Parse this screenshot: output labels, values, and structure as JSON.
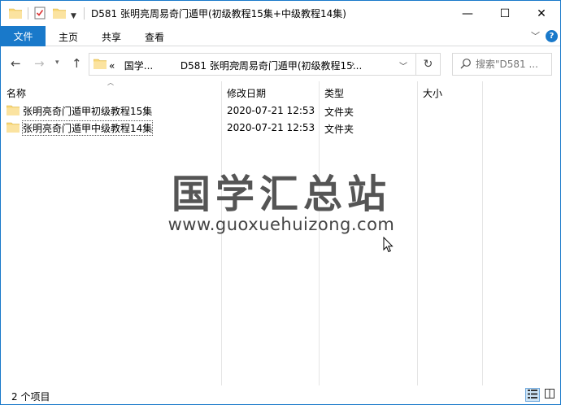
{
  "window": {
    "title": "D581 张明亮周易奇门遁甲(初级教程15集+中级教程14集)",
    "minimize": "—",
    "maximize": "☐",
    "close": "✕"
  },
  "ribbon": {
    "tabs": [
      "文件",
      "主页",
      "共享",
      "查看"
    ],
    "help": "?"
  },
  "nav": {
    "address_breadcrumb": [
      "国学...",
      "D581 张明亮周易奇门遁甲(初级教程15..."
    ],
    "address_prefix": "«",
    "search_placeholder": "搜索\"D581 ..."
  },
  "columns": {
    "name": "名称",
    "date": "修改日期",
    "type": "类型",
    "size": "大小"
  },
  "files": [
    {
      "name": "张明亮奇门遁甲初级教程15集",
      "date": "2020-07-21 12:53",
      "type": "文件夹",
      "size": ""
    },
    {
      "name": "张明亮奇门遁甲中级教程14集",
      "date": "2020-07-21 12:53",
      "type": "文件夹",
      "size": ""
    }
  ],
  "watermark": {
    "title": "国学汇总站",
    "url": "www.guoxuehuizong.com"
  },
  "status": {
    "count": "2 个项目"
  },
  "colors": {
    "accent": "#1979ca",
    "folder": "#f8d775"
  },
  "icons": {
    "folder": "folder-icon",
    "properties": "properties-check-icon",
    "back": "arrow-left-icon",
    "forward": "arrow-right-icon",
    "up": "arrow-up-icon",
    "refresh": "refresh-icon",
    "search": "search-icon"
  }
}
